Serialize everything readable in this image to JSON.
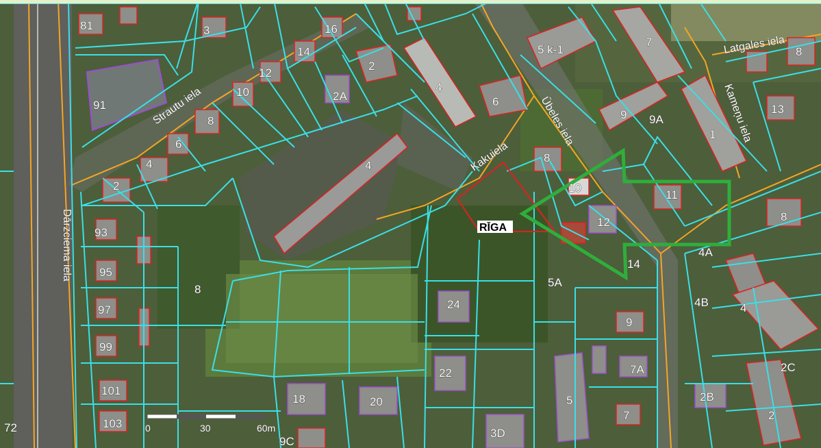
{
  "map": {
    "city_label": "RĪGA",
    "streets": {
      "straut": "Strautu iela",
      "kakui": "Kakuiela",
      "ubeles": "Ūbeles iela",
      "darzciema": "Dārzciema iela",
      "latgales": "Latgales iela",
      "kamenu": "Kameņu iela"
    },
    "parcels": {
      "p81": "81",
      "p3": "3",
      "p16": "16",
      "p14a": "14",
      "p2a": "2",
      "p4a": "4",
      "p6a": "6",
      "p5k1": "5 k-1",
      "p7a": "7",
      "p8a": "8",
      "p91": "91",
      "p12a": "12",
      "p10": "10",
      "p2A": "2A",
      "p9a": "9",
      "p9A": "9A",
      "p13": "13",
      "p1": "1",
      "p8b": "8",
      "p6b": "6",
      "p4b": "4",
      "p4c": "4",
      "p2b": "2",
      "p8c": "8",
      "p10b": "10",
      "p11": "11",
      "p12b": "12",
      "p8d": "8",
      "p93": "93",
      "p95": "95",
      "p97": "97",
      "p99": "99",
      "p101": "101",
      "p103": "103",
      "p72": "72",
      "p8e": "8",
      "p24": "24",
      "p5A": "5A",
      "p14b": "14",
      "p4A": "4A",
      "p4B": "4B",
      "p4d": "4",
      "p9b": "9",
      "p7A": "7A",
      "p22": "22",
      "p18": "18",
      "p20": "20",
      "p9C": "9C",
      "p3D": "3D",
      "p5": "5",
      "p7b": "7",
      "p2B": "2B",
      "p2C": "2C",
      "p2c": "2"
    },
    "scale": {
      "zero": "0",
      "mid": "30",
      "end": "60m"
    },
    "colors": {
      "parcel_border": "#39e0e8",
      "road_line": "#f5a623",
      "building_red": "#e02020",
      "building_purple": "#9b4fd0",
      "arrow": "#2fae3c"
    }
  }
}
